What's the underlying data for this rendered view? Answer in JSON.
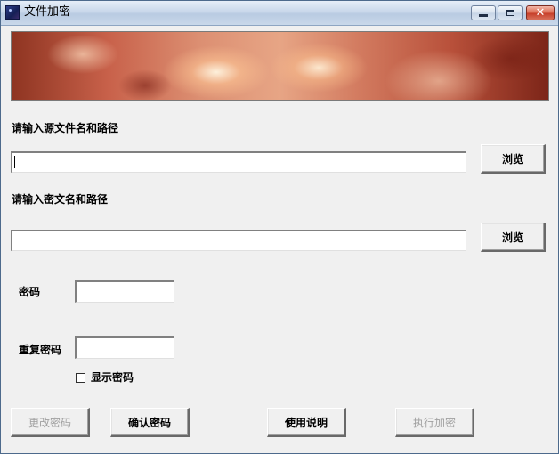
{
  "window": {
    "title": "文件加密",
    "minimize_icon": "minimize-icon",
    "maximize_icon": "maximize-icon",
    "close_icon": "close-icon",
    "close_glyph": "✕"
  },
  "banner": {
    "description_icon": "banner-image"
  },
  "source": {
    "label": "请输入源文件名和路径",
    "value": "",
    "browse_label": "浏览"
  },
  "cipher": {
    "label": "请输入密文名和路径",
    "value": "",
    "browse_label": "浏览"
  },
  "password": {
    "label": "密码",
    "value": "",
    "repeat_label": "重复密码",
    "repeat_value": "",
    "show_password_label": "显示密码",
    "show_password_checked": false
  },
  "buttons": {
    "change_password": "更改密码",
    "confirm_password": "确认密码",
    "instructions": "使用说明",
    "run_encrypt": "执行加密"
  }
}
